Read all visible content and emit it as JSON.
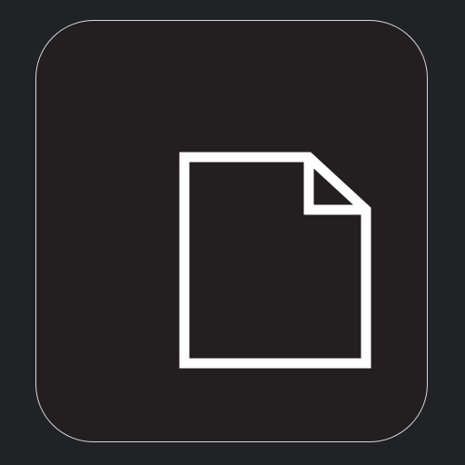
{
  "icon": {
    "name": "document-icon",
    "stroke_color": "#ffffff",
    "tile_color": "#231f20",
    "tile_border_color": "#d9d9d9",
    "background_color": "#212226"
  }
}
